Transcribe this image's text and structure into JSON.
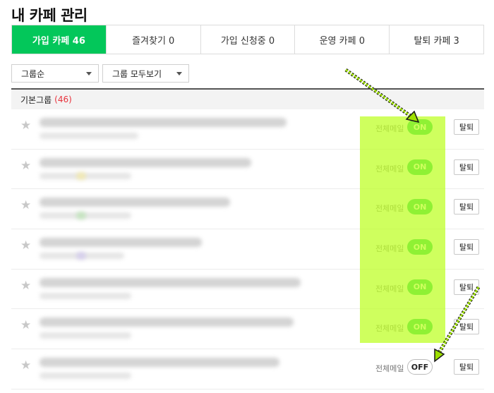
{
  "page_title": "내 카페 관리",
  "tabs": [
    {
      "label": "가입 카페 46",
      "active": true
    },
    {
      "label": "즐겨찾기 0",
      "active": false
    },
    {
      "label": "가입 신청중 0",
      "active": false
    },
    {
      "label": "운영 카페 0",
      "active": false
    },
    {
      "label": "탈퇴 카페 3",
      "active": false
    }
  ],
  "filters": {
    "sort_label": "그룹순",
    "group_label": "그룹 모두보기"
  },
  "group": {
    "name": "기본그룹",
    "count": "(46)"
  },
  "cafes": [
    {
      "mail_label": "전체메일",
      "toggle": "ON",
      "leave_label": "탈퇴"
    },
    {
      "mail_label": "전체메일",
      "toggle": "ON",
      "leave_label": "탈퇴"
    },
    {
      "mail_label": "전체메일",
      "toggle": "ON",
      "leave_label": "탈퇴"
    },
    {
      "mail_label": "전체메일",
      "toggle": "ON",
      "leave_label": "탈퇴"
    },
    {
      "mail_label": "전체메일",
      "toggle": "ON",
      "leave_label": "탈퇴"
    },
    {
      "mail_label": "전체메일",
      "toggle": "ON",
      "leave_label": "탈퇴"
    },
    {
      "mail_label": "전체메일",
      "toggle": "OFF",
      "leave_label": "탈퇴"
    }
  ],
  "star_glyph": "★",
  "colors": {
    "accent": "#03c75a",
    "highlight": "#bfff28",
    "count_red": "#e8323c",
    "arrow": "#9ee000"
  }
}
